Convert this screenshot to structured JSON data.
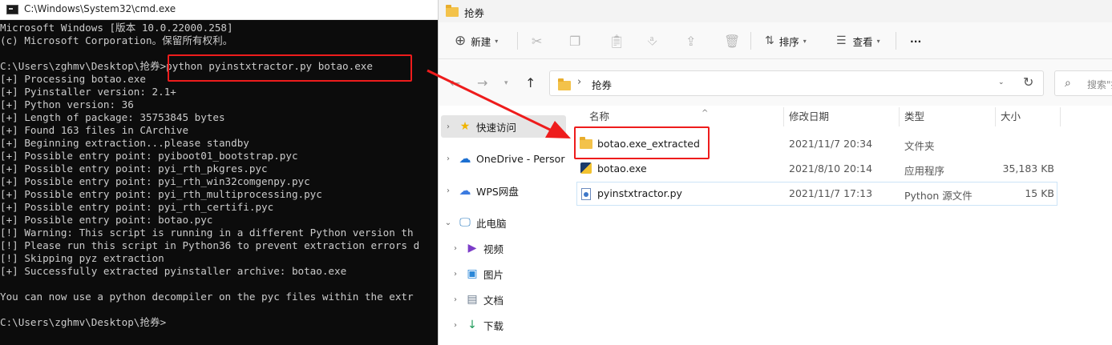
{
  "cmd": {
    "title": "C:\\Windows\\System32\\cmd.exe",
    "lines": [
      "Microsoft Windows [版本 10.0.22000.258]",
      "(c) Microsoft Corporation。保留所有权利。",
      "",
      "C:\\Users\\zghmv\\Desktop\\抢券>python pyinstxtractor.py botao.exe",
      "[+] Processing botao.exe",
      "[+] Pyinstaller version: 2.1+",
      "[+] Python version: 36",
      "[+] Length of package: 35753845 bytes",
      "[+] Found 163 files in CArchive",
      "[+] Beginning extraction...please standby",
      "[+] Possible entry point: pyiboot01_bootstrap.pyc",
      "[+] Possible entry point: pyi_rth_pkgres.pyc",
      "[+] Possible entry point: pyi_rth_win32comgenpy.pyc",
      "[+] Possible entry point: pyi_rth_multiprocessing.pyc",
      "[+] Possible entry point: pyi_rth_certifi.pyc",
      "[+] Possible entry point: botao.pyc",
      "[!] Warning: This script is running in a different Python version th",
      "[!] Please run this script in Python36 to prevent extraction errors d",
      "[!] Skipping pyz extraction",
      "[+] Successfully extracted pyinstaller archive: botao.exe",
      "",
      "You can now use a python decompiler on the pyc files within the extr",
      "",
      "C:\\Users\\zghmv\\Desktop\\抢券>"
    ]
  },
  "explorer": {
    "title": "抢券",
    "toolbar": {
      "new_label": "新建",
      "sort_label": "排序",
      "view_label": "查看",
      "more_label": "···"
    },
    "address": {
      "path": "抢券",
      "search_placeholder": "搜索\"抢"
    },
    "nav": {
      "items": [
        {
          "label": "快速访问",
          "icon": "star-icon"
        },
        {
          "label": "OneDrive - Persor",
          "icon": "cloud-icon"
        },
        {
          "label": "WPS网盘",
          "icon": "wps-cloud-icon"
        },
        {
          "label": "此电脑",
          "icon": "monitor-icon"
        },
        {
          "label": "视频",
          "icon": "video-icon"
        },
        {
          "label": "图片",
          "icon": "picture-icon"
        },
        {
          "label": "文档",
          "icon": "document-icon"
        },
        {
          "label": "下载",
          "icon": "download-icon"
        }
      ]
    },
    "columns": {
      "name": "名称",
      "date": "修改日期",
      "type": "类型",
      "size": "大小"
    },
    "files": [
      {
        "name": "botao.exe_extracted",
        "date": "2021/11/7 20:34",
        "type": "文件夹",
        "size": ""
      },
      {
        "name": "botao.exe",
        "date": "2021/8/10 20:14",
        "type": "应用程序",
        "size": "35,183 KB"
      },
      {
        "name": "pyinstxtractor.py",
        "date": "2021/11/7 17:13",
        "type": "Python 源文件",
        "size": "15 KB"
      }
    ]
  },
  "colors": {
    "highlight": "#ee1c1c",
    "terminal_bg": "#0c0c0c",
    "terminal_fg": "#cccccc",
    "folder": "#f3c24a"
  }
}
